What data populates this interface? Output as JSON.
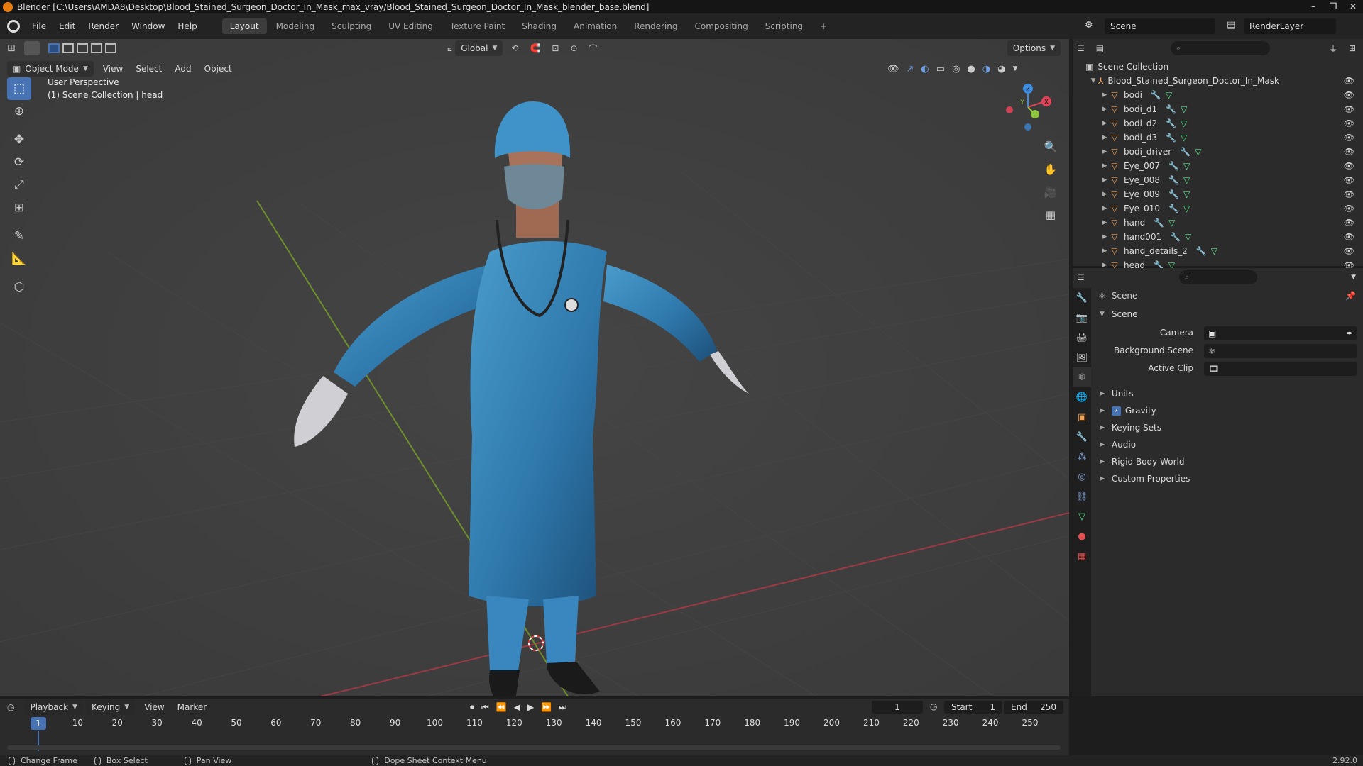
{
  "window": {
    "title": "Blender [C:\\Users\\AMDA8\\Desktop\\Blood_Stained_Surgeon_Doctor_In_Mask_max_vray/Blood_Stained_Surgeon_Doctor_In_Mask_blender_base.blend]",
    "controls": [
      "–",
      "❐",
      "✕"
    ]
  },
  "menubar": {
    "items": [
      "File",
      "Edit",
      "Render",
      "Window",
      "Help"
    ]
  },
  "workspaces": {
    "tabs": [
      "Layout",
      "Modeling",
      "Sculpting",
      "UV Editing",
      "Texture Paint",
      "Shading",
      "Animation",
      "Rendering",
      "Compositing",
      "Scripting"
    ],
    "active": "Layout",
    "add": "+"
  },
  "scene": {
    "name": "Scene",
    "view_layer": "RenderLayer"
  },
  "viewport": {
    "transform_orientation": "Global",
    "options_label": "Options",
    "mode": "Object Mode",
    "menus": [
      "View",
      "Select",
      "Add",
      "Object"
    ],
    "info_line1": "User Perspective",
    "info_line2": "(1) Scene Collection | head",
    "gizmo_axes": {
      "x": "X",
      "y": "Y",
      "z": "Z"
    }
  },
  "outliner": {
    "search_placeholder": "",
    "root": "Scene Collection",
    "collection": "Blood_Stained_Surgeon_Doctor_In_Mask",
    "objects": [
      {
        "name": "bodi"
      },
      {
        "name": "bodi_d1"
      },
      {
        "name": "bodi_d2"
      },
      {
        "name": "bodi_d3"
      },
      {
        "name": "bodi_driver"
      },
      {
        "name": "Eye_007"
      },
      {
        "name": "Eye_008"
      },
      {
        "name": "Eye_009"
      },
      {
        "name": "Eye_010"
      },
      {
        "name": "hand"
      },
      {
        "name": "hand001"
      },
      {
        "name": "hand_details_2"
      },
      {
        "name": "head"
      }
    ]
  },
  "properties": {
    "context_title": "Scene",
    "panel_title": "Scene",
    "fields": [
      {
        "label": "Camera",
        "value": ""
      },
      {
        "label": "Background Scene",
        "value": ""
      },
      {
        "label": "Active Clip",
        "value": ""
      }
    ],
    "subpanels": [
      "Units",
      "Gravity",
      "Keying Sets",
      "Audio",
      "Rigid Body World",
      "Custom Properties"
    ],
    "gravity_checked": true
  },
  "timeline": {
    "menus": [
      "Playback",
      "Keying",
      "View",
      "Marker"
    ],
    "current_frame": "1",
    "start_label": "Start",
    "start": "1",
    "end_label": "End",
    "end": "250",
    "ruler": [
      "10",
      "20",
      "30",
      "40",
      "50",
      "60",
      "70",
      "80",
      "90",
      "100",
      "110",
      "120",
      "130",
      "140",
      "150",
      "160",
      "170",
      "180",
      "190",
      "200",
      "210",
      "220",
      "230",
      "240",
      "250"
    ]
  },
  "statusbar": {
    "items": [
      "Change Frame",
      "Box Select",
      "Pan View",
      "Dope Sheet Context Menu"
    ],
    "version": "2.92.0"
  },
  "colors": {
    "accent": "#4772b3",
    "viewport_bg": "#3f3f3f",
    "axis_x": "#e0455a",
    "axis_y": "#8ec63f",
    "axis_z": "#3a8ee6",
    "object_icon": "#f0a25a",
    "mesh_icon": "#5fe08a"
  }
}
